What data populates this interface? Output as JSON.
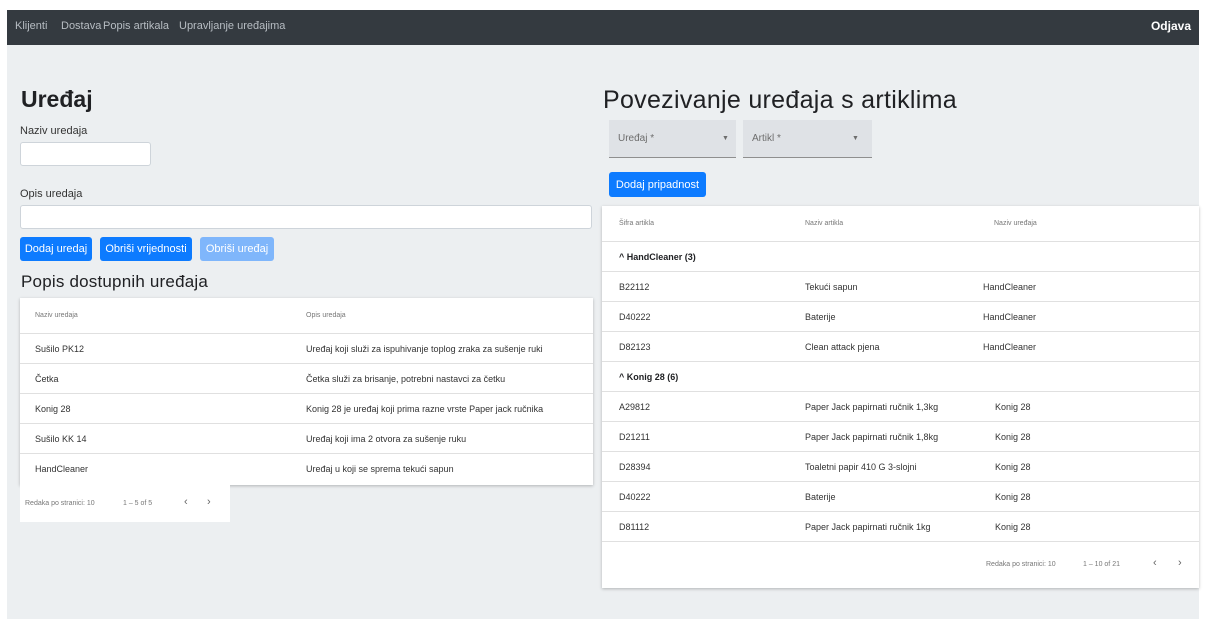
{
  "navbar": {
    "links": [
      "Klijenti",
      "Dostava",
      "Popis artikala",
      "Upravljanje uređajima"
    ],
    "logout": "Odjava"
  },
  "device_form": {
    "title": "Uređaj",
    "name_label": "Naziv uredaja",
    "name_value": "",
    "description_label": "Opis uredaja",
    "description_value": "",
    "buttons": {
      "add": "Dodaj uredaj",
      "clear": "Obriši vrijednosti",
      "delete": "Obriši uređaj"
    }
  },
  "device_list": {
    "title": "Popis dostupnih uređaja",
    "headers": [
      "Naziv uredaja",
      "Opis uredaja"
    ],
    "rows": [
      [
        "Sušilo PK12",
        "Uređaj koji služi za ispuhivanje toplog zraka za sušenje ruki"
      ],
      [
        "Četka",
        "Četka služi za brisanje, potrebni nastavci za četku"
      ],
      [
        "Konig 28",
        "Konig 28 je uređaj koji prima razne vrste Paper jack ručnika"
      ],
      [
        "Sušilo KK 14",
        "Uređaj koji ima 2 otvora za sušenje ruku"
      ],
      [
        "HandCleaner",
        "Uređaj u koji se sprema tekući sapun"
      ]
    ],
    "pager": {
      "rows_per_page": "Redaka po stranici: 10",
      "range": "1 – 5 of 5",
      "prev": "‹",
      "next": "›"
    }
  },
  "link_panel": {
    "title": "Povezivanje uređaja s artiklima",
    "device_select": "Uređaj *",
    "article_select": "Artikl *",
    "dropdown_icon": "▼",
    "add_button": "Dodaj pripadnost",
    "headers": [
      "Šifra artikla",
      "Naziv artikla",
      "Naziv uređaja"
    ],
    "groups": [
      {
        "title": "^  HandCleaner (3)",
        "rows": [
          [
            "B22112",
            "Tekući sapun",
            "HandCleaner"
          ],
          [
            "D40222",
            "Baterije",
            "HandCleaner"
          ],
          [
            "D82123",
            "Clean attack pjena",
            "HandCleaner"
          ]
        ]
      },
      {
        "title": "^  Konig 28 (6)",
        "rows": [
          [
            "A29812",
            "Paper Jack papirnati ručnik 1,3kg",
            "Konig 28"
          ],
          [
            "D21211",
            "Paper Jack papirnati ručnik 1,8kg",
            "Konig 28"
          ],
          [
            "D28394",
            "Toaletni papir 410 G 3-slojni",
            "Konig 28"
          ],
          [
            "D40222",
            "Baterije",
            "Konig 28"
          ],
          [
            "D81112",
            "Paper Jack papirnati ručnik 1kg",
            "Konig 28"
          ]
        ]
      }
    ],
    "pager": {
      "rows_per_page": "Redaka po stranici: 10",
      "range": "1 – 10 of 21",
      "prev": "‹",
      "next": "›"
    }
  }
}
